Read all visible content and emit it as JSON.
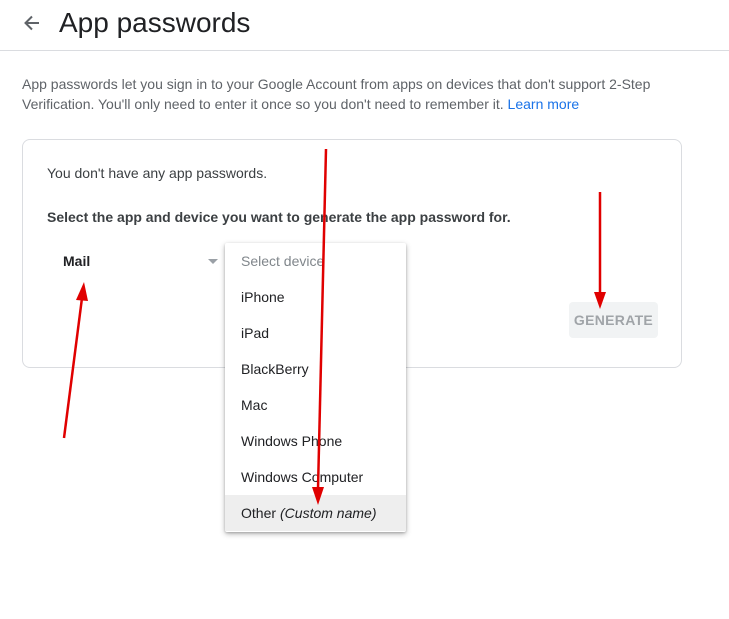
{
  "header": {
    "title": "App passwords",
    "back_icon": "arrow-left-icon"
  },
  "intro": {
    "text": "App passwords let you sign in to your Google Account from apps on devices that don't support 2-Step Verification. You'll only need to enter it once so you don't need to remember it. ",
    "learn_more": "Learn more"
  },
  "card": {
    "no_passwords": "You don't have any app passwords.",
    "prompt": "Select the app and device you want to generate the app password for.",
    "app_select": {
      "value": "Mail"
    },
    "generate_label": "GENERATE"
  },
  "device_dropdown": {
    "placeholder": "Select device",
    "options": [
      "iPhone",
      "iPad",
      "BlackBerry",
      "Mac",
      "Windows Phone",
      "Windows Computer"
    ],
    "other": {
      "label": "Other",
      "hint": "(Custom name)"
    }
  },
  "colors": {
    "accent_link": "#1a73e8",
    "annotation_red": "#e00000",
    "divider": "#dadce0"
  }
}
